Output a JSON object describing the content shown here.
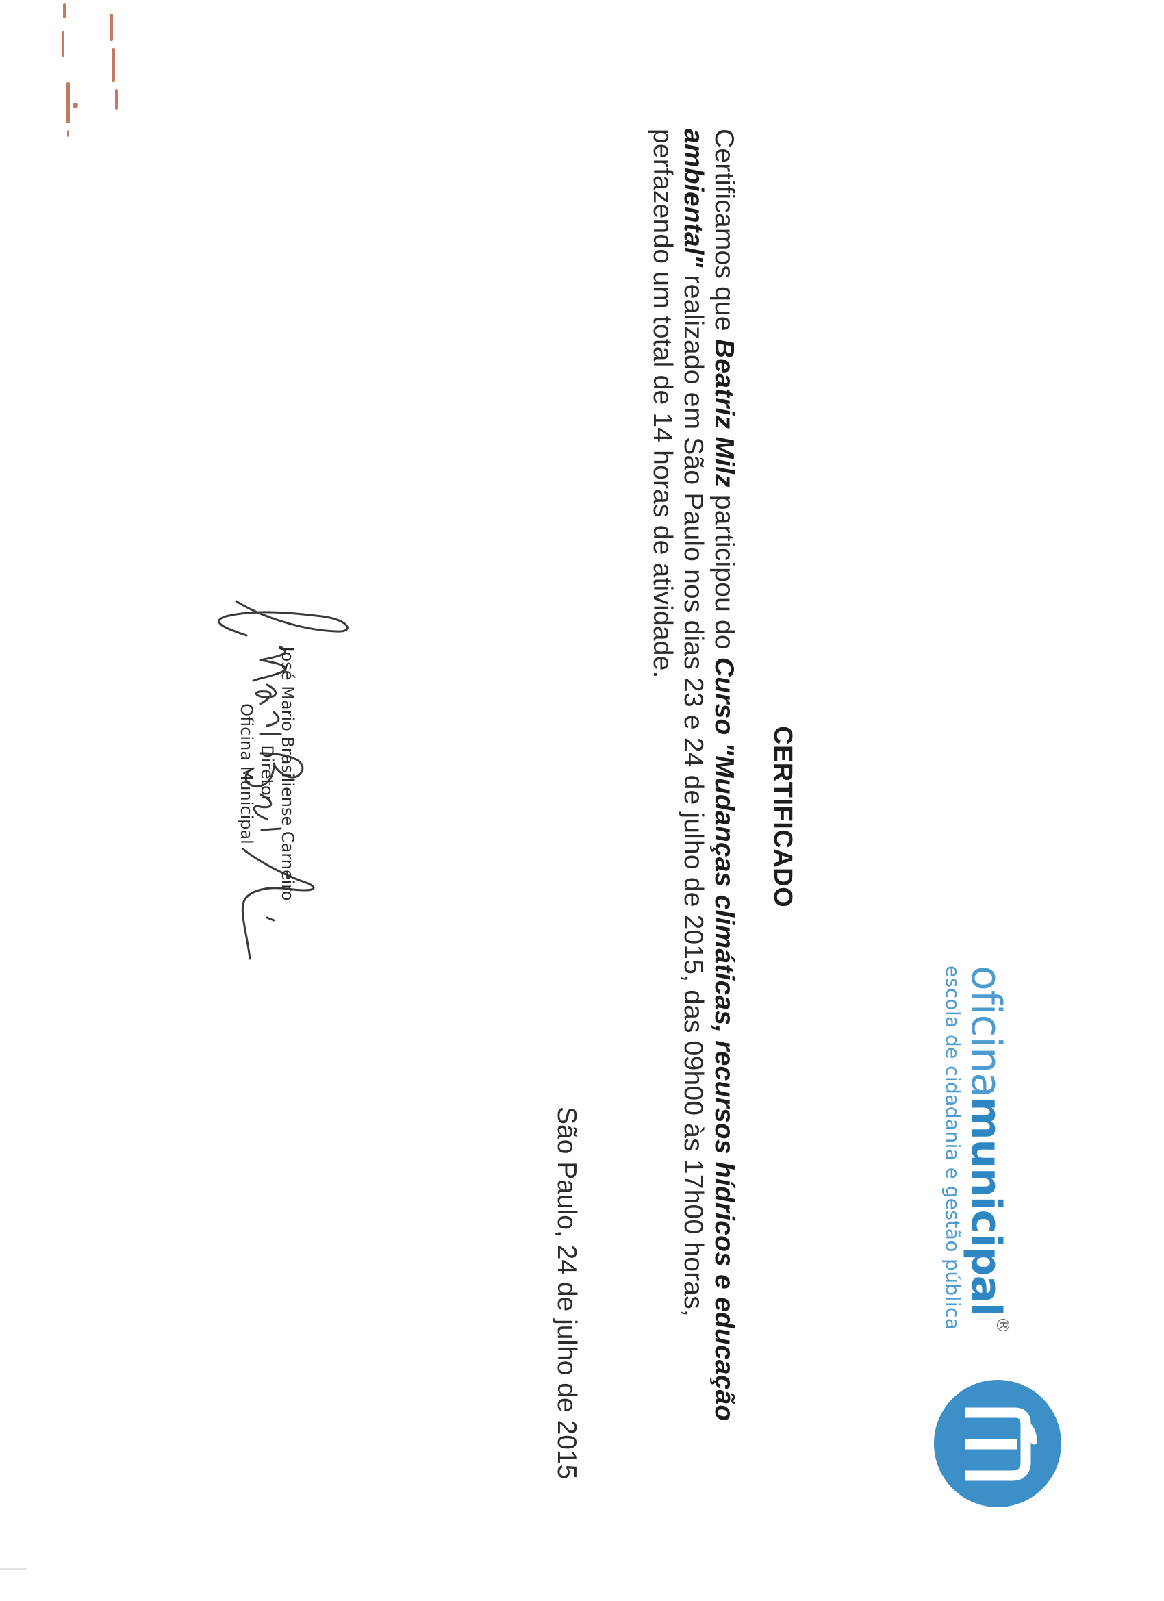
{
  "logo": {
    "brand_light": "oficina",
    "brand_bold": "municipal",
    "registered_mark": "R",
    "tagline": "escola de cidadania e gestão pública",
    "color": "#3c8fc7"
  },
  "certificate": {
    "title": "CERTIFICADO",
    "text_intro": "Certificamos que",
    "participant": "Beatriz Milz",
    "text_participated": "participou do",
    "course": "Curso \"Mudanças climáticas, recursos hídricos e educação ambiental\"",
    "text_details": "realizado em São Paulo nos dias 23 e 24 de julho de 2015, das 09h00 às 17h00 horas, perfazendo um total de 14 horas de atividade.",
    "place_date": "São Paulo, 24 de julho de 2015"
  },
  "signatory": {
    "name": "José Mario Brasiliense Carneiro",
    "role": "Diretor",
    "organization": "Oficina Municipal"
  }
}
